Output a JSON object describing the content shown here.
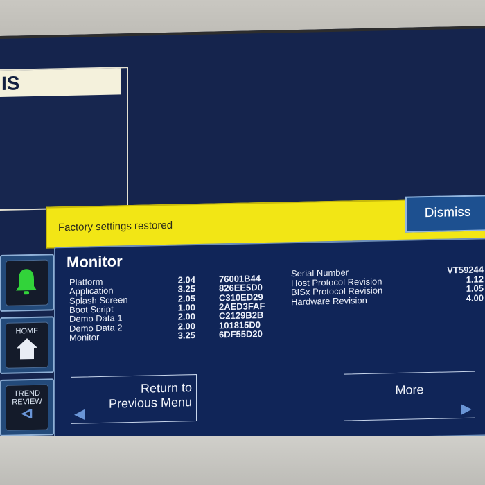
{
  "title": {
    "label": "IS"
  },
  "notification": {
    "message": "Factory settings restored",
    "dismiss_label": "Dismiss"
  },
  "side": {
    "home_label": "HOME",
    "trend_label_1": "TREND",
    "trend_label_2": "REVIEW"
  },
  "panel": {
    "title": "Monitor",
    "software": [
      {
        "name": "Platform",
        "version": "2.04",
        "checksum": "76001B44"
      },
      {
        "name": "Application",
        "version": "3.25",
        "checksum": "826EE5D0"
      },
      {
        "name": "Splash Screen",
        "version": "2.05",
        "checksum": "C310ED29"
      },
      {
        "name": "Boot Script",
        "version": "1.00",
        "checksum": "2AED3FAF"
      },
      {
        "name": "Demo Data 1",
        "version": "2.00",
        "checksum": "C2129B2B"
      },
      {
        "name": "Demo Data 2",
        "version": "2.00",
        "checksum": "101815D0"
      },
      {
        "name": "Monitor",
        "version": "3.25",
        "checksum": "6DF55D20"
      }
    ],
    "info": [
      {
        "name": "Serial Number",
        "value": "VT59244"
      },
      {
        "name": "Host Protocol Revision",
        "value": "1.12"
      },
      {
        "name": "BISx Protocol Revision",
        "value": "1.05"
      },
      {
        "name": "Hardware Revision",
        "value": "4.00"
      }
    ]
  },
  "buttons": {
    "return_line1": "Return to",
    "return_line2": "Previous Menu",
    "more": "More"
  },
  "colors": {
    "notice": "#f2e615",
    "screen": "#15244d",
    "button_accent": "#6a95d6",
    "bell": "#32d33a"
  }
}
